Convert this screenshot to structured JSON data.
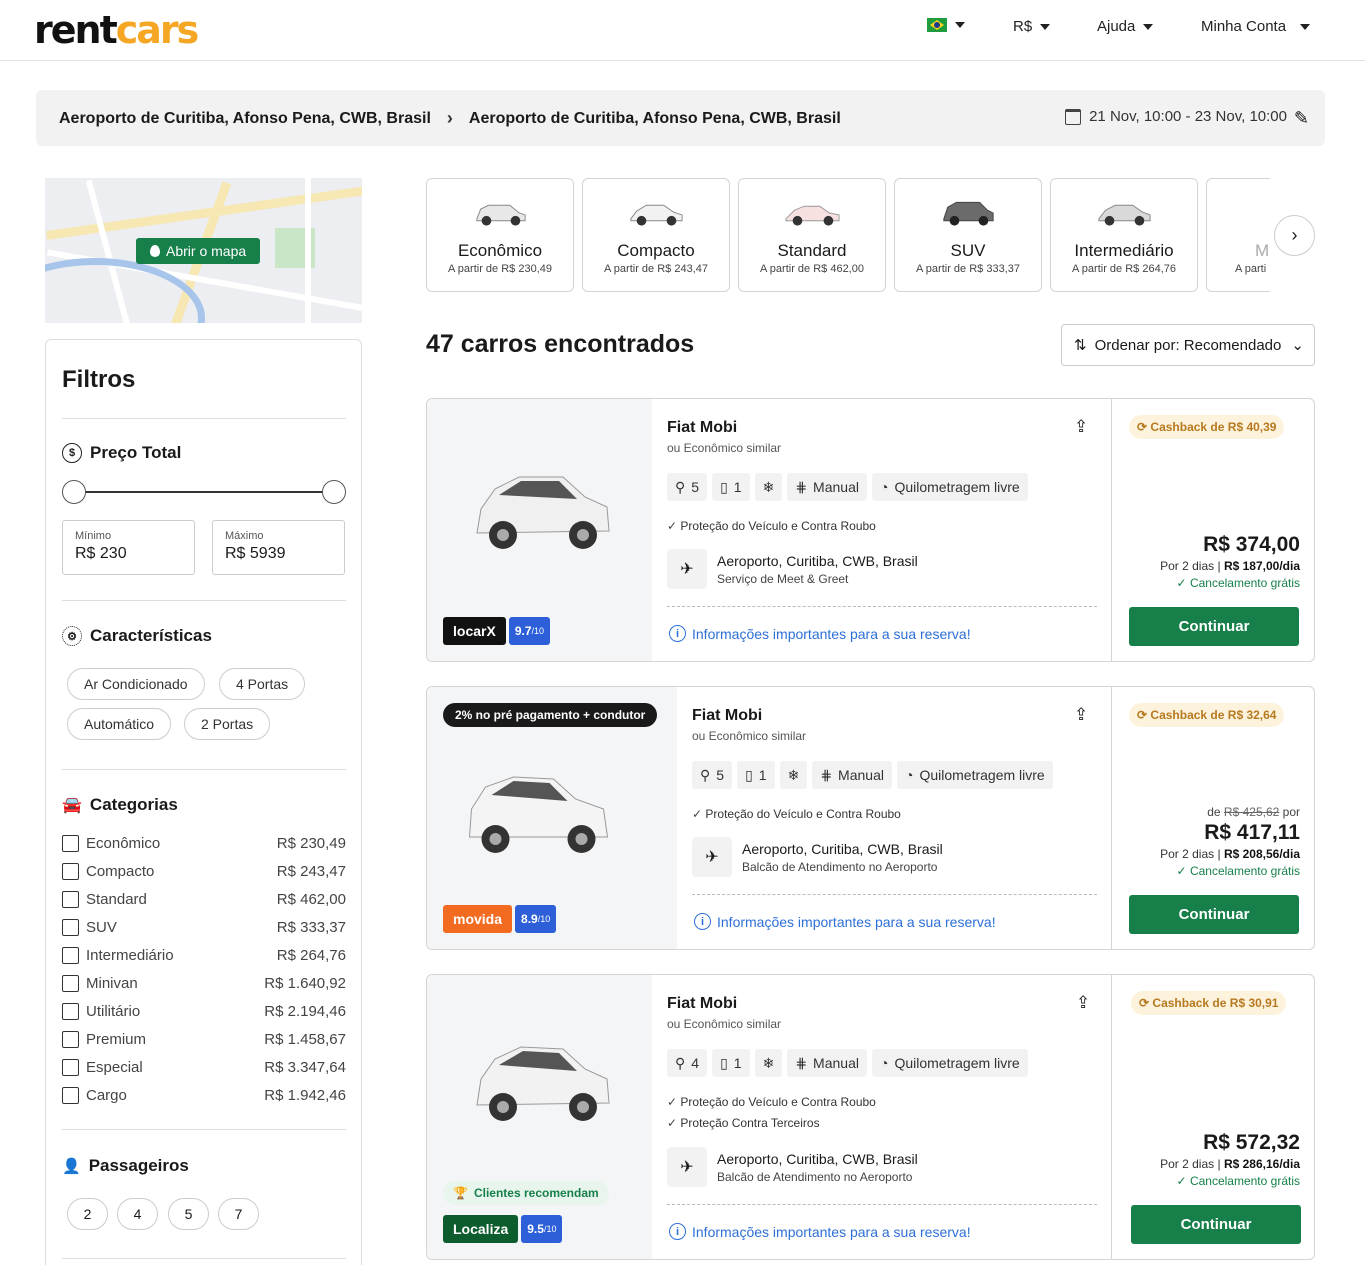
{
  "header": {
    "logo": {
      "part1": "rent",
      "part2": "cars"
    },
    "nav": {
      "currency": "R$",
      "help": "Ajuda",
      "account": "Minha Conta"
    }
  },
  "search": {
    "pickup": "Aeroporto de Curitiba, Afonso Pena, CWB, Brasil",
    "dropoff": "Aeroporto de Curitiba, Afonso Pena, CWB, Brasil",
    "dates": "21 Nov, 10:00 - 23 Nov, 10:00"
  },
  "map": {
    "button": "Abrir o mapa"
  },
  "filters": {
    "title": "Filtros",
    "price": {
      "title": "Preço Total",
      "min_label": "Mínimo",
      "min_value": "R$ 230",
      "max_label": "Máximo",
      "max_value": "R$ 5939"
    },
    "features": {
      "title": "Características",
      "chips": [
        "Ar Condicionado",
        "4 Portas",
        "Automático",
        "2 Portas"
      ]
    },
    "categories": {
      "title": "Categorias",
      "items": [
        {
          "name": "Econômico",
          "price": "R$ 230,49"
        },
        {
          "name": "Compacto",
          "price": "R$ 243,47"
        },
        {
          "name": "Standard",
          "price": "R$ 462,00"
        },
        {
          "name": "SUV",
          "price": "R$ 333,37"
        },
        {
          "name": "Intermediário",
          "price": "R$ 264,76"
        },
        {
          "name": "Minivan",
          "price": "R$ 1.640,92"
        },
        {
          "name": "Utilitário",
          "price": "R$ 2.194,46"
        },
        {
          "name": "Premium",
          "price": "R$ 1.458,67"
        },
        {
          "name": "Especial",
          "price": "R$ 3.347,64"
        },
        {
          "name": "Cargo",
          "price": "R$ 1.942,46"
        }
      ]
    },
    "passengers": {
      "title": "Passageiros",
      "options": [
        "2",
        "4",
        "5",
        "7"
      ]
    }
  },
  "category_tiles": [
    {
      "name": "Econômico",
      "price": "A partir de R$ 230,49"
    },
    {
      "name": "Compacto",
      "price": "A partir de R$ 243,47"
    },
    {
      "name": "Standard",
      "price": "A partir de R$ 462,00"
    },
    {
      "name": "SUV",
      "price": "A partir de R$ 333,37"
    },
    {
      "name": "Intermediário",
      "price": "A partir de R$ 264,76"
    },
    {
      "name": "M",
      "price": "A parti"
    }
  ],
  "results": {
    "count_text": "47 carros encontrados",
    "sort_label": "Ordenar por: Recomendado",
    "cards": [
      {
        "promo": "",
        "vendor": "locarX",
        "vendor_color": "#111111",
        "score": "9.7",
        "score_suffix": "/10",
        "name": "Fiat Mobi",
        "similar": "ou Econômico similar",
        "passengers": "5",
        "bags": "1",
        "transmission": "Manual",
        "mileage": "Quilometragem livre",
        "protections": [
          "Proteção do Veículo e Contra Roubo"
        ],
        "location": "Aeroporto, Curitiba, CWB, Brasil",
        "service": "Serviço de Meet & Greet",
        "info": "Informações importantes para a sua reserva!",
        "cashback": "Cashback de R$ 40,39",
        "old_price_prefix": "",
        "old_price": "",
        "old_price_suffix": "",
        "price": "R$ 374,00",
        "days": "Por 2 dias |",
        "per_day": "R$ 187,00/dia",
        "cancel": "Cancelamento grátis",
        "cta": "Continuar"
      },
      {
        "promo": "2% no pré pagamento + condutor",
        "vendor": "movida",
        "vendor_color": "#f26b21",
        "score": "8.9",
        "score_suffix": "/10",
        "name": "Fiat Mobi",
        "similar": "ou Econômico similar",
        "passengers": "5",
        "bags": "1",
        "transmission": "Manual",
        "mileage": "Quilometragem livre",
        "protections": [
          "Proteção do Veículo e Contra Roubo"
        ],
        "location": "Aeroporto, Curitiba, CWB, Brasil",
        "service": "Balcão de Atendimento no Aeroporto",
        "info": "Informações importantes para a sua reserva!",
        "cashback": "Cashback de R$ 32,64",
        "old_price_prefix": "de",
        "old_price": "R$ 425,62",
        "old_price_suffix": "por",
        "price": "R$ 417,11",
        "days": "Por 2 dias |",
        "per_day": "R$ 208,56/dia",
        "cancel": "Cancelamento grátis",
        "cta": "Continuar"
      },
      {
        "promo": "",
        "recommend": "Clientes recomendam",
        "vendor": "Localiza",
        "vendor_color": "#0d5c2e",
        "score": "9.5",
        "score_suffix": "/10",
        "name": "Fiat Mobi",
        "similar": "ou Econômico similar",
        "passengers": "4",
        "bags": "1",
        "transmission": "Manual",
        "mileage": "Quilometragem livre",
        "protections": [
          "Proteção do Veículo e Contra Roubo",
          "Proteção Contra Terceiros"
        ],
        "location": "Aeroporto, Curitiba, CWB, Brasil",
        "service": "Balcão de Atendimento no Aeroporto",
        "info": "Informações importantes para a sua reserva!",
        "cashback": "Cashback de R$ 30,91",
        "old_price_prefix": "",
        "old_price": "",
        "old_price_suffix": "",
        "price": "R$ 572,32",
        "days": "Por 2 dias |",
        "per_day": "R$ 286,16/dia",
        "cancel": "Cancelamento grátis",
        "cta": "Continuar"
      }
    ]
  },
  "colors": {
    "brand_green": "#17804a",
    "accent_orange": "#f5a623",
    "link_blue": "#2d6fd8"
  }
}
